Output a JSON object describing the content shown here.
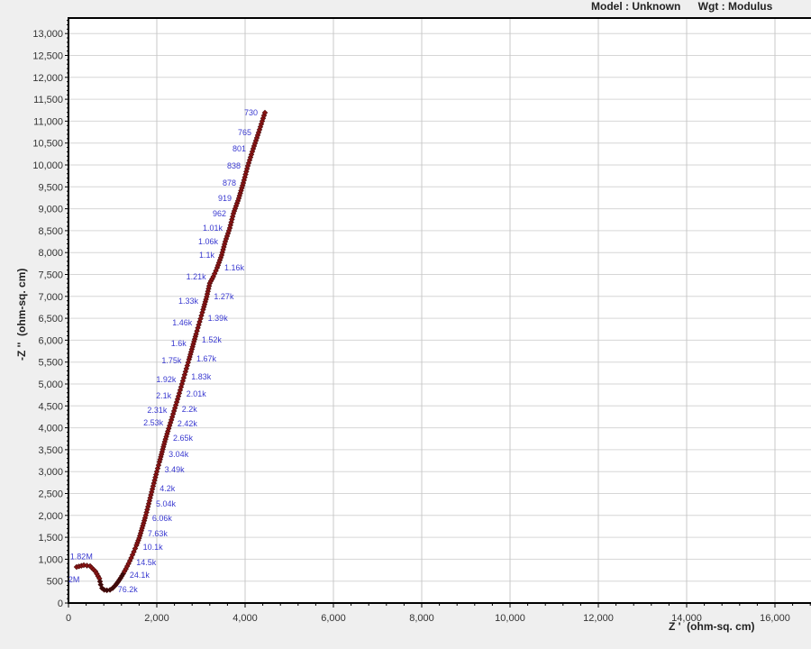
{
  "header": {
    "model": "Model : Unknown",
    "weighting": "Wgt : Modulus"
  },
  "chart_data": {
    "type": "scatter",
    "title": "",
    "xlabel": "Z '  (ohm-sq. cm)",
    "ylabel": "-Z ''  (ohm-sq. cm)",
    "xlim": [
      0,
      16900
    ],
    "ylim": [
      0,
      13300
    ],
    "xticks": [
      0,
      2000,
      4000,
      6000,
      8000,
      10000,
      12000,
      14000,
      16000
    ],
    "xtick_labels": [
      "0",
      "2,000",
      "4,000",
      "6,000",
      "8,000",
      "10,000",
      "12,000",
      "14,000",
      "16,000"
    ],
    "yticks": [
      0,
      500,
      1000,
      1500,
      2000,
      2500,
      3000,
      3500,
      4000,
      4500,
      5000,
      5500,
      6000,
      6500,
      7000,
      7500,
      8000,
      8500,
      9000,
      9500,
      10000,
      10500,
      11000,
      11500,
      12000,
      12500,
      13000
    ],
    "ytick_labels": [
      "0",
      "500",
      "1,000",
      "1,500",
      "2,000",
      "2,500",
      "3,000",
      "3,500",
      "4,000",
      "4,500",
      "5,000",
      "5,500",
      "6,000",
      "6,500",
      "7,000",
      "7,500",
      "8,000",
      "8,500",
      "9,000",
      "9,500",
      "10,000",
      "10,500",
      "11,000",
      "11,500",
      "12,000",
      "12,500",
      "13,000"
    ],
    "grid": true,
    "marker_color": "#8b1515",
    "label_color": "#3a3ad0",
    "points": [
      [
        184,
        823
      ],
      [
        347,
        864
      ],
      [
        490,
        843
      ],
      [
        612,
        720
      ],
      [
        700,
        560
      ],
      [
        730,
        420
      ],
      [
        760,
        340
      ],
      [
        810,
        300
      ],
      [
        870,
        290
      ],
      [
        940,
        300
      ],
      [
        1000,
        340
      ],
      [
        1060,
        400
      ],
      [
        1120,
        480
      ],
      [
        1180,
        570
      ],
      [
        1240,
        670
      ],
      [
        1300,
        780
      ],
      [
        1360,
        900
      ],
      [
        1420,
        1030
      ],
      [
        1480,
        1170
      ],
      [
        1540,
        1320
      ],
      [
        1600,
        1480
      ],
      [
        1650,
        1650
      ],
      [
        1700,
        1820
      ],
      [
        1750,
        2000
      ],
      [
        1800,
        2200
      ],
      [
        1850,
        2400
      ],
      [
        1900,
        2600
      ],
      [
        1950,
        2800
      ],
      [
        2000,
        3000
      ],
      [
        2060,
        3220
      ],
      [
        2120,
        3450
      ],
      [
        2180,
        3680
      ],
      [
        2250,
        3920
      ],
      [
        2330,
        4180
      ],
      [
        2410,
        4450
      ],
      [
        2490,
        4720
      ],
      [
        2570,
        5000
      ],
      [
        2650,
        5280
      ],
      [
        2730,
        5560
      ],
      [
        2810,
        5850
      ],
      [
        2890,
        6140
      ],
      [
        2970,
        6420
      ],
      [
        3050,
        6700
      ],
      [
        3130,
        6990
      ],
      [
        3200,
        7300
      ],
      [
        3280,
        7450
      ],
      [
        3367,
        7654
      ],
      [
        3469,
        7942
      ],
      [
        3551,
        8251
      ],
      [
        3653,
        8560
      ],
      [
        3735,
        8889
      ],
      [
        3857,
        9239
      ],
      [
        3959,
        9588
      ],
      [
        4061,
        9979
      ],
      [
        4184,
        10370
      ],
      [
        4306,
        10741
      ],
      [
        4449,
        11193
      ]
    ],
    "freq_labels": [
      {
        "text": "730",
        "z_im": 11193,
        "side": "left"
      },
      {
        "text": "765",
        "z_im": 10741,
        "side": "left"
      },
      {
        "text": "801",
        "z_im": 10370,
        "side": "left"
      },
      {
        "text": "838",
        "z_im": 9979,
        "side": "left"
      },
      {
        "text": "878",
        "z_im": 9588,
        "side": "left"
      },
      {
        "text": "919",
        "z_im": 9239,
        "side": "left"
      },
      {
        "text": "962",
        "z_im": 8889,
        "side": "left"
      },
      {
        "text": "1.01k",
        "z_im": 8560,
        "side": "left"
      },
      {
        "text": "1.06k",
        "z_im": 8251,
        "side": "left"
      },
      {
        "text": "1.1k",
        "z_im": 7942,
        "side": "left"
      },
      {
        "text": "1.16k",
        "z_im": 7654,
        "side": "right"
      },
      {
        "text": "1.21k",
        "z_im": 7449,
        "side": "left"
      },
      {
        "text": "1.27k",
        "z_im": 6996,
        "side": "right"
      },
      {
        "text": "1.33k",
        "z_im": 6893,
        "side": "left"
      },
      {
        "text": "1.39k",
        "z_im": 6502,
        "side": "right"
      },
      {
        "text": "1.46k",
        "z_im": 6399,
        "side": "left"
      },
      {
        "text": "1.52k",
        "z_im": 6008,
        "side": "right"
      },
      {
        "text": "1.6k",
        "z_im": 5926,
        "side": "left"
      },
      {
        "text": "1.67k",
        "z_im": 5576,
        "side": "right"
      },
      {
        "text": "1.75k",
        "z_im": 5535,
        "side": "left"
      },
      {
        "text": "1.83k",
        "z_im": 5165,
        "side": "right"
      },
      {
        "text": "1.92k",
        "z_im": 5103,
        "side": "left"
      },
      {
        "text": "2.01k",
        "z_im": 4774,
        "side": "right"
      },
      {
        "text": "2.1k",
        "z_im": 4733,
        "side": "left"
      },
      {
        "text": "2.2k",
        "z_im": 4424,
        "side": "right"
      },
      {
        "text": "2.31k",
        "z_im": 4403,
        "side": "left"
      },
      {
        "text": "2.42k",
        "z_im": 4095,
        "side": "right"
      },
      {
        "text": "2.53k",
        "z_im": 4115,
        "side": "left"
      },
      {
        "text": "2.65k",
        "z_im": 3765,
        "side": "right"
      },
      {
        "text": "3.04k",
        "z_im": 3395,
        "side": "right"
      },
      {
        "text": "3.49k",
        "z_im": 3045,
        "side": "right"
      },
      {
        "text": "4.2k",
        "z_im": 2613,
        "side": "right"
      },
      {
        "text": "5.04k",
        "z_im": 2263,
        "side": "right"
      },
      {
        "text": "6.06k",
        "z_im": 1934,
        "side": "right"
      },
      {
        "text": "7.63k",
        "z_im": 1584,
        "side": "right"
      },
      {
        "text": "10.1k",
        "z_im": 1276,
        "side": "right"
      },
      {
        "text": "14.5k",
        "z_im": 926,
        "side": "right"
      },
      {
        "text": "24.1k",
        "z_im": 638,
        "side": "right"
      },
      {
        "text": "76.2k",
        "z_im": 309,
        "side": "right"
      },
      {
        "text": "1.82M",
        "z_im": 1060,
        "z_re": 200,
        "side": "free"
      },
      {
        "text": "2M",
        "z_im": 540,
        "z_re": 160,
        "side": "free"
      }
    ]
  }
}
